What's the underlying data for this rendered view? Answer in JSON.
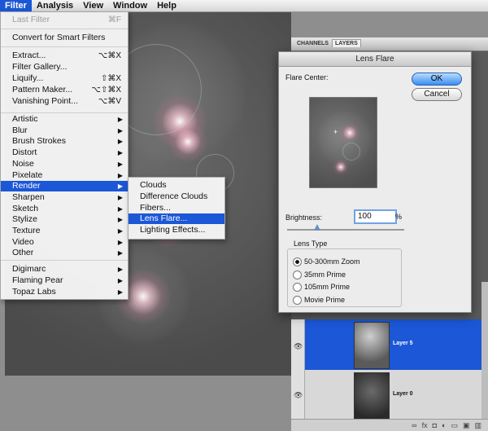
{
  "menubar": {
    "items": [
      "Filter",
      "Analysis",
      "View",
      "Window",
      "Help"
    ]
  },
  "filter_menu": {
    "last_filter": {
      "label": "Last Filter",
      "shortcut": "⌘F"
    },
    "convert": "Convert for Smart Filters",
    "group1": [
      {
        "label": "Extract...",
        "shortcut": "⌥⌘X"
      },
      {
        "label": "Filter Gallery...",
        "shortcut": ""
      },
      {
        "label": "Liquify...",
        "shortcut": "⇧⌘X"
      },
      {
        "label": "Pattern Maker...",
        "shortcut": "⌥⇧⌘X"
      },
      {
        "label": "Vanishing Point...",
        "shortcut": "⌥⌘V"
      }
    ],
    "group2": [
      "Artistic",
      "Blur",
      "Brush Strokes",
      "Distort",
      "Noise",
      "Pixelate",
      "Render",
      "Sharpen",
      "Sketch",
      "Stylize",
      "Texture",
      "Video",
      "Other"
    ],
    "group3": [
      "Digimarc",
      "Flaming Pear",
      "Topaz Labs"
    ],
    "arrow": "▶"
  },
  "render_submenu": {
    "items": [
      "Clouds",
      "Difference Clouds",
      "Fibers...",
      "Lens Flare...",
      "Lighting Effects..."
    ],
    "selected": "Lens Flare..."
  },
  "panel": {
    "tabs": [
      "CHANNELS",
      "LAYERS"
    ],
    "layers": [
      "Layer 5",
      "Layer 0"
    ],
    "footer_icons": [
      "fx"
    ]
  },
  "dialog": {
    "title": "Lens Flare",
    "flare_center_label": "Flare Center:",
    "ok": "OK",
    "cancel": "Cancel",
    "brightness_label": "Brightness:",
    "brightness_value": "100",
    "percent": "%",
    "brightness_fraction": 0.26,
    "lens_type_label": "Lens Type",
    "lens_types": [
      "50-300mm Zoom",
      "35mm Prime",
      "105mm Prime",
      "Movie Prime"
    ],
    "selected_lens": "50-300mm Zoom"
  },
  "colors": {
    "accent": "#1b57d6",
    "panel_dark": "#5a5a5a",
    "dialog_bg": "#ececec"
  }
}
